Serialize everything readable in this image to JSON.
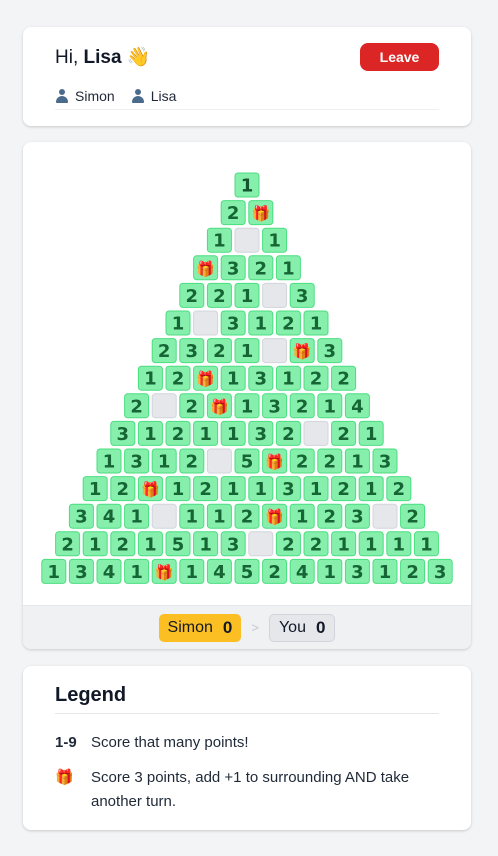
{
  "header": {
    "greeting_prefix": "Hi,",
    "user_name": "Lisa",
    "wave_emoji": "👋",
    "leave_label": "Leave",
    "players": [
      "Simon",
      "Lisa"
    ]
  },
  "board": {
    "gift_symbol": "🎁",
    "rows": [
      [
        "1"
      ],
      [
        "2",
        "G"
      ],
      [
        "1",
        "",
        "1"
      ],
      [
        "G",
        "3",
        "2",
        "1"
      ],
      [
        "2",
        "2",
        "1",
        "",
        "3"
      ],
      [
        "1",
        "",
        "3",
        "1",
        "2",
        "1"
      ],
      [
        "2",
        "3",
        "2",
        "1",
        "",
        "G",
        "3"
      ],
      [
        "1",
        "2",
        "G",
        "1",
        "3",
        "1",
        "2",
        "2"
      ],
      [
        "2",
        "",
        "2",
        "G",
        "1",
        "3",
        "2",
        "1",
        "4"
      ],
      [
        "3",
        "1",
        "2",
        "1",
        "1",
        "3",
        "2",
        "",
        "2",
        "1"
      ],
      [
        "1",
        "3",
        "1",
        "2",
        "",
        "5",
        "G",
        "2",
        "2",
        "1",
        "3"
      ],
      [
        "1",
        "2",
        "G",
        "1",
        "2",
        "1",
        "1",
        "3",
        "1",
        "2",
        "1",
        "2"
      ],
      [
        "3",
        "4",
        "1",
        "",
        "1",
        "1",
        "2",
        "G",
        "1",
        "2",
        "3",
        "",
        "2"
      ],
      [
        "2",
        "1",
        "2",
        "1",
        "5",
        "1",
        "3",
        "",
        "2",
        "2",
        "1",
        "1",
        "1",
        "1"
      ],
      [
        "1",
        "3",
        "4",
        "1",
        "G",
        "1",
        "4",
        "5",
        "2",
        "4",
        "1",
        "3",
        "1",
        "2",
        "3"
      ]
    ],
    "colors": {
      "tile_fill": "#86efac",
      "tile_border": "#4ade80",
      "tile_text": "#166534",
      "top_tile_text": "#14532d",
      "hidden_fill": "#e5e7eb",
      "hidden_border": "#d1d5db"
    }
  },
  "scores": {
    "player1_name": "Simon",
    "player1_score": "0",
    "turn_indicator": ">",
    "player2_name": "You",
    "player2_score": "0",
    "active_color": "#fbbf24"
  },
  "legend": {
    "title": "Legend",
    "items": [
      {
        "key": "1-9",
        "text": "Score that many points!"
      },
      {
        "key": "🎁",
        "text": "Score 3 points, add +1 to surrounding AND take another turn."
      }
    ]
  }
}
